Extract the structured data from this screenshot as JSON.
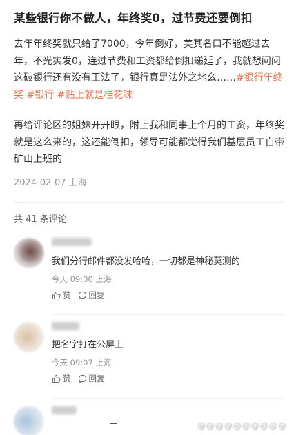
{
  "post": {
    "title": "某些银行你不做人，年终奖0，过节费还要倒扣",
    "paragraph1_text": "去年年终奖就只给了7000，今年倒好，美其名曰不能超过去年，不光实发0，连过节费和工资都给倒扣递延了，我就想问问这破银行还有没有王法了，银行真是法外之地么……",
    "tags": [
      "#银行年终奖",
      "#银行",
      "#贴上就是桂花味"
    ],
    "paragraph2_text": "再给评论区的姐妹开开眼，附上我和同事上个月的工资，年终奖就是这么来的，这还能倒扣，领导可能都觉得我们基层员工自带矿山上班的",
    "date": "2024-02-07 上海"
  },
  "comments_header": "共 41 条评论",
  "comments": [
    {
      "text": "我们分行邮件都没发哈哈，一切都是神秘莫测的",
      "time": "今天 09:00 上海",
      "like_label": "赞",
      "reply_label": "回复"
    },
    {
      "text": "把名字打在公屏上",
      "time": "今天 09:07 上海",
      "like_label": "赞",
      "reply_label": "回复"
    }
  ],
  "watermark": "@@@@@@@@@@",
  "colors": {
    "tag": "#eb7350",
    "meta": "#939393",
    "text": "#333333"
  }
}
